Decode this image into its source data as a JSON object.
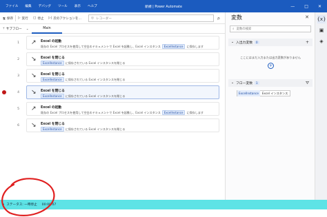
{
  "titlebar": {
    "menu": [
      "ファイル",
      "編集",
      "デバッグ",
      "ツール",
      "表示",
      "ヘルプ"
    ],
    "title": "新規 | Power Automate",
    "buttons": [
      "—",
      "□",
      "✕"
    ]
  },
  "toolbar": {
    "save_label": "保存",
    "run_label": "実行",
    "stop_label": "停止",
    "step_label": "次のアクションを...",
    "search_placeholder": "レコーダー"
  },
  "subflow": {
    "dropdown_label": "サブフロー",
    "tab_main": "Main"
  },
  "actions": [
    {
      "line": "1",
      "icon": "launch-excel-icon",
      "title": "Excel の起動",
      "desc_pre": "既存の Excel プロセスを使用して空白のドキュメントで Excel を起動し、Excel インスタンス",
      "chip": "ExcelInstance",
      "desc_post": "に保存します",
      "selected": false,
      "breakpoint": false
    },
    {
      "line": "2",
      "icon": "close-excel-icon",
      "title": "Excel を閉じる",
      "desc_pre": "",
      "chip": "ExcelInstance",
      "desc_post": "に保存されている Excel インスタンスを閉じる",
      "selected": false,
      "breakpoint": false
    },
    {
      "line": "3",
      "icon": "close-excel-icon",
      "title": "Excel を閉じる",
      "desc_pre": "",
      "chip": "ExcelInstance",
      "desc_post": "に保存されている Excel インスタンスを閉じる",
      "selected": false,
      "breakpoint": false
    },
    {
      "line": "4",
      "icon": "close-excel-icon",
      "title": "Excel を閉じる",
      "desc_pre": "",
      "chip": "ExcelInstance",
      "desc_post": "に保存されている Excel インスタンスを閉じる",
      "selected": true,
      "breakpoint": true
    },
    {
      "line": "5",
      "icon": "launch-excel-icon",
      "title": "Excel の起動",
      "desc_pre": "既存の Excel プロセスを使用して空白のドキュメントで Excel を起動し、Excel インスタンス",
      "chip": "ExcelInstance",
      "desc_post": "に保存します",
      "selected": false,
      "breakpoint": false
    },
    {
      "line": "6",
      "icon": "close-excel-icon",
      "title": "Excel を閉じる",
      "desc_pre": "",
      "chip": "ExcelInstance",
      "desc_post": "に保存されている Excel インスタンスを閉じる",
      "selected": false,
      "breakpoint": false
    }
  ],
  "variables": {
    "title": "変数",
    "search_placeholder": "変数の検索",
    "input_section": {
      "label": "入出力変数",
      "count": "0"
    },
    "input_empty_text": "ここにはまだ入力または出力変数がありません",
    "flow_section": {
      "label": "フロー変数",
      "count": "1"
    },
    "flow_vars": [
      {
        "name": "ExcelInstance",
        "type": "Excel インスタンス"
      }
    ]
  },
  "status": {
    "label": "ステータス: 一時停止",
    "time": "00:00:07"
  },
  "colors": {
    "titlebar": "#1b5bbf",
    "status_bar": "#5ee3e6",
    "breakpoint": "#c01818",
    "annotation": "#e02020"
  }
}
